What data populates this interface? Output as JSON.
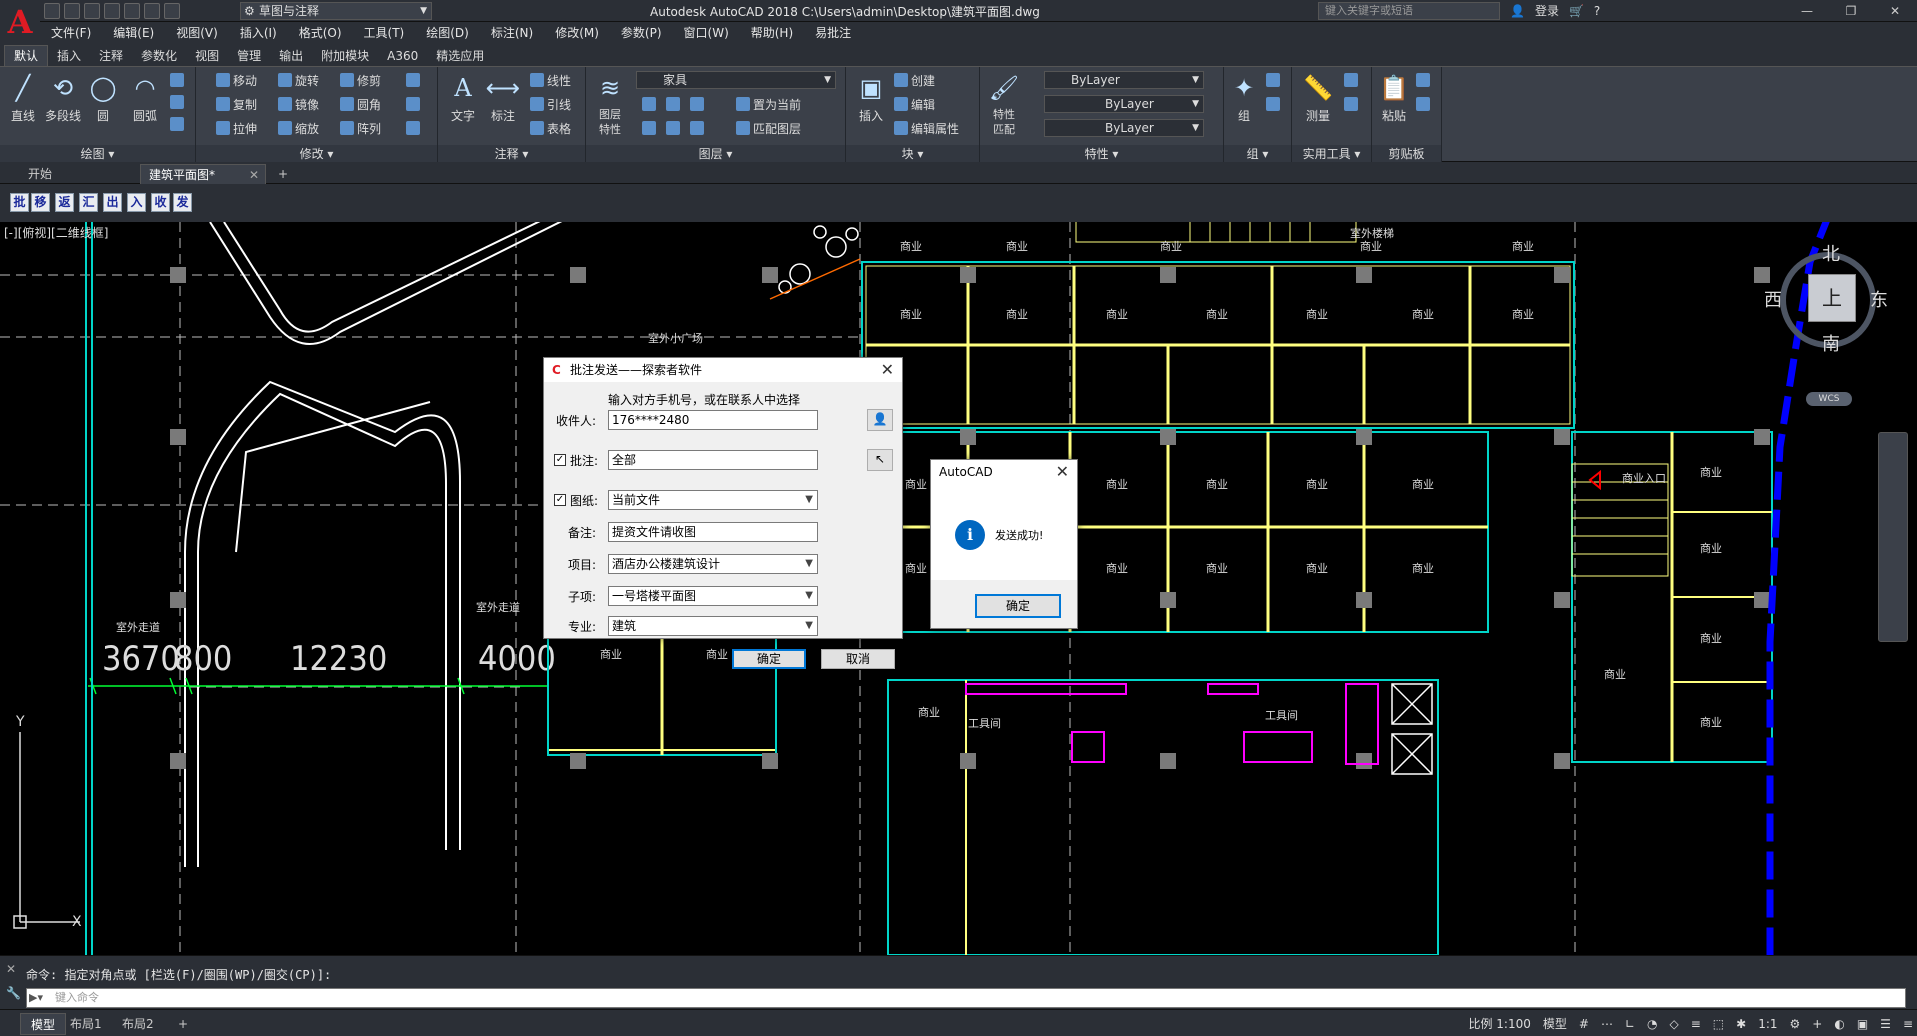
{
  "title_bar": {
    "workspace": "草图与注释",
    "app_title": "Autodesk AutoCAD 2018    C:\\Users\\admin\\Desktop\\建筑平面图.dwg",
    "search_placeholder": "键入关键字或短语",
    "login": "登录"
  },
  "menu": [
    "文件(F)",
    "编辑(E)",
    "视图(V)",
    "插入(I)",
    "格式(O)",
    "工具(T)",
    "绘图(D)",
    "标注(N)",
    "修改(M)",
    "参数(P)",
    "窗口(W)",
    "帮助(H)",
    "易批注"
  ],
  "ribbon_tabs": [
    "默认",
    "插入",
    "注释",
    "参数化",
    "视图",
    "管理",
    "输出",
    "附加模块",
    "A360",
    "精选应用"
  ],
  "ribbon": {
    "draw": {
      "title": "绘图 ▾",
      "line": "直线",
      "polyline": "多段线",
      "circle": "圆",
      "arc": "圆弧"
    },
    "modify": {
      "title": "修改 ▾",
      "move": "移动",
      "rotate": "旋转",
      "trim": "修剪",
      "copy": "复制",
      "mirror": "镜像",
      "fillet": "圆角",
      "stretch": "拉伸",
      "scale": "缩放",
      "array": "阵列"
    },
    "annotation": {
      "title": "注释 ▾",
      "text": "文字",
      "dim": "标注",
      "linear": "线性",
      "leader": "引线",
      "table": "表格"
    },
    "layers": {
      "title": "图层 ▾",
      "props": "图层\n特性",
      "current_layer": "家具",
      "set_current": "置为当前",
      "match": "匹配图层"
    },
    "block": {
      "title": "块 ▾",
      "insert": "插入",
      "create": "创建",
      "edit": "编辑",
      "edit_attr": "编辑属性"
    },
    "properties": {
      "title": "特性 ▾",
      "match": "特性\n匹配",
      "color": "ByLayer",
      "linetype": "ByLayer",
      "lineweight": "ByLayer"
    },
    "groups": {
      "title": "组 ▾",
      "group": "组"
    },
    "utilities": {
      "title": "实用工具 ▾",
      "measure": "测量"
    },
    "clipboard": {
      "title": "剪贴板",
      "paste": "粘贴"
    }
  },
  "doc_tabs": [
    "开始",
    "建筑平面图*"
  ],
  "custom_toolbar": [
    "批",
    "移",
    "返",
    "汇",
    "出",
    "入",
    "收",
    "发"
  ],
  "canvas": {
    "view_label": "[-][俯视][二维线框]",
    "viewcube": {
      "north": "北",
      "south": "南",
      "east": "东",
      "west": "西",
      "top": "上",
      "wcs": "WCS"
    },
    "dims": [
      "3670",
      "800",
      "12230",
      "4000"
    ],
    "texts": [
      "室外走道",
      "室外走道",
      "室外小广场",
      "室外楼梯",
      "商业入口",
      "工具间",
      "工具间"
    ],
    "unit_label": "商业",
    "axis_y": "Y",
    "axis_x": "X"
  },
  "batch_dialog": {
    "title": "批注发送——探索者软件",
    "hint": "输入对方手机号，或在联系人中选择",
    "recipient_label": "收件人:",
    "recipient_value": "176****2480",
    "annotation_label": "批注:",
    "annotation_value": "全部",
    "drawing_label": "图纸:",
    "drawing_value": "当前文件",
    "note_label": "备注:",
    "note_value": "提资文件请收图",
    "project_label": "项目:",
    "project_value": "酒店办公楼建筑设计",
    "subitem_label": "子项:",
    "subitem_value": "一号塔楼平面图",
    "discipline_label": "专业:",
    "discipline_value": "建筑",
    "ok": "确定",
    "cancel": "取消"
  },
  "msg_dialog": {
    "title": "AutoCAD",
    "message": "发送成功!",
    "ok": "确定"
  },
  "command": {
    "history": "命令: 指定对角点或 [栏选(F)/圈围(WP)/圈交(CP)]:",
    "placeholder": "键入命令"
  },
  "status": {
    "layout_tabs": [
      "模型",
      "布局1",
      "布局2"
    ],
    "scale": "比例 1:100",
    "model": "模型",
    "annot_scale": "1:1"
  },
  "colors": {
    "accent": "#0078d7",
    "wall": "#00d5c9",
    "frame": "#ffffff",
    "yellow": "#ffff80",
    "magenta": "#ff00ff",
    "green": "#00ff33",
    "blue": "#0000ff"
  }
}
